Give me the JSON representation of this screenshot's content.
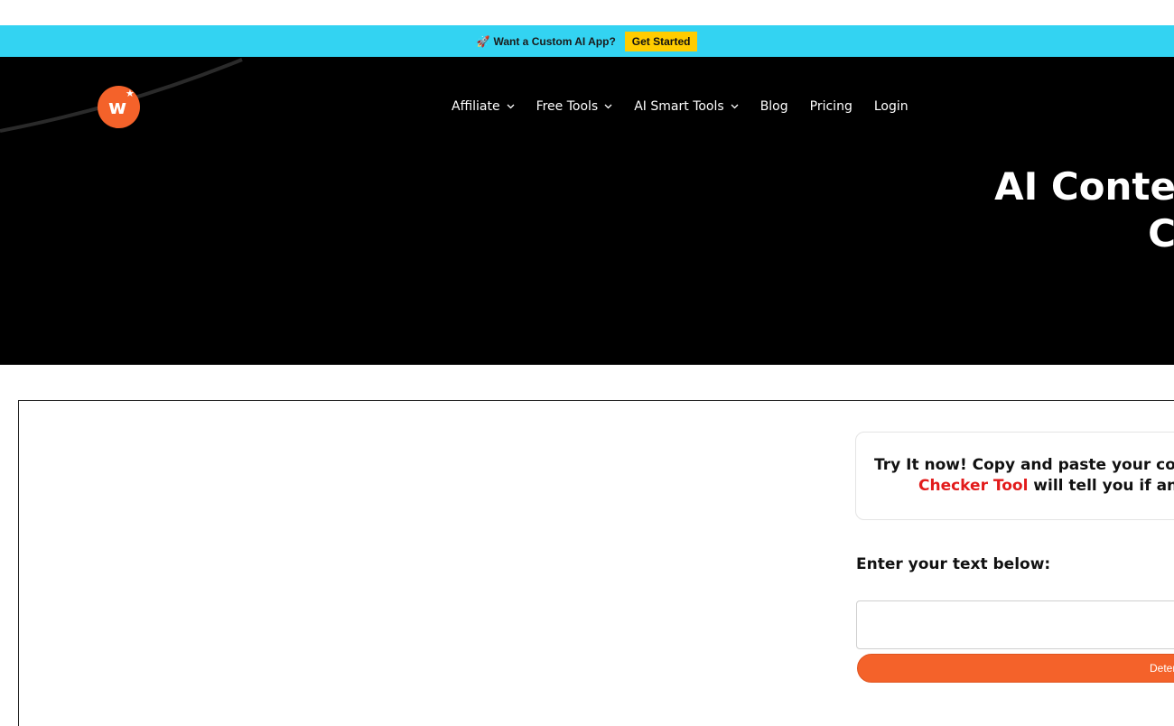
{
  "promo": {
    "text": "Want a Custom AI App?",
    "icon": "rocket-icon",
    "button_label": "Get Started",
    "bar_color": "#33d3f2",
    "button_color": "#ffcc00"
  },
  "header": {
    "logo_letter": "w",
    "logo_color": "#f4622a",
    "nav": [
      {
        "label": "Affiliate",
        "has_dropdown": true
      },
      {
        "label": "Free Tools",
        "has_dropdown": true
      },
      {
        "label": "AI Smart Tools",
        "has_dropdown": true
      },
      {
        "label": "Blog",
        "has_dropdown": false
      },
      {
        "label": "Pricing",
        "has_dropdown": false
      },
      {
        "label": "Login",
        "has_dropdown": false
      }
    ]
  },
  "hero": {
    "title_line1": "AI Conte",
    "title_line2": "C"
  },
  "tool": {
    "intro_line1": "Try It now! Copy and paste your conter",
    "intro_link": "Checker Tool",
    "intro_line2_rest": " will tell you if any o",
    "input_label": "Enter your text below:",
    "input_value": "",
    "button_label": "Deter",
    "button_color": "#f4622a",
    "link_color": "#e21b1b"
  }
}
